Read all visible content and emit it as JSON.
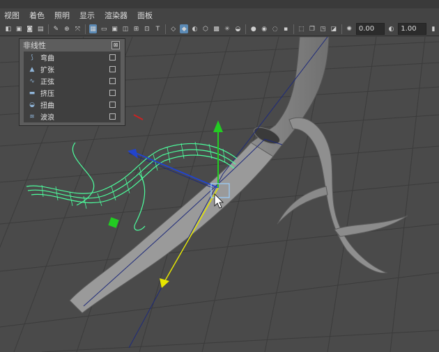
{
  "menu": [
    "视图",
    "着色",
    "照明",
    "显示",
    "渲染器",
    "面板"
  ],
  "toolbar": {
    "field1": "0.00",
    "field2": "1.00"
  },
  "nonlinear_panel": {
    "title": "非线性",
    "close_glyph": "⊠",
    "items": [
      {
        "label": "弯曲",
        "icon": "bend-icon"
      },
      {
        "label": "扩张",
        "icon": "flare-icon"
      },
      {
        "label": "正弦",
        "icon": "sine-icon"
      },
      {
        "label": "挤压",
        "icon": "squash-icon"
      },
      {
        "label": "扭曲",
        "icon": "twist-icon"
      },
      {
        "label": "波浪",
        "icon": "wave-icon"
      }
    ]
  },
  "colors": {
    "viewport_bg": "#4a4a4a",
    "grid_line": "#3b3b3b",
    "tube_fill": "#8e8e8e",
    "nurbs_green": "#4dff9e",
    "manip_yellow": "#e6e600",
    "manip_blue": "#2244cc",
    "manip_green": "#22cc22",
    "manip_red": "#cc2222"
  }
}
